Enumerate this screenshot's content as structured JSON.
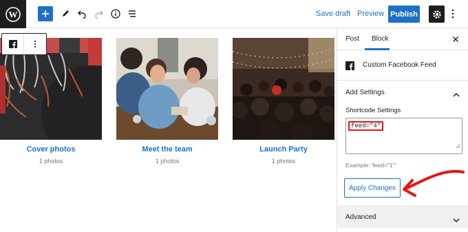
{
  "toolbar": {
    "save_draft": "Save draft",
    "preview": "Preview",
    "publish": "Publish",
    "icons": [
      "wordpress-logo",
      "add-block",
      "edit-pencil",
      "undo",
      "redo",
      "info",
      "list-view",
      "settings-gear",
      "more-vertical"
    ]
  },
  "albums": [
    {
      "title": "Cover photos",
      "count": "1 photos"
    },
    {
      "title": "Meet the team",
      "count": "1 photos"
    },
    {
      "title": "Launch Party",
      "count": "1 photos"
    }
  ],
  "sidebar": {
    "tab_post": "Post",
    "tab_block": "Block",
    "block_name": "Custom Facebook Feed",
    "add_settings": "Add Settings",
    "shortcode_label": "Shortcode Settings",
    "shortcode_value": "feed=\"4\"",
    "example": "Example: 'feed=\"1\"'",
    "apply": "Apply Changes",
    "advanced": "Advanced"
  },
  "colors": {
    "accent": "#1e6fc6",
    "annotation_red": "#e11"
  }
}
